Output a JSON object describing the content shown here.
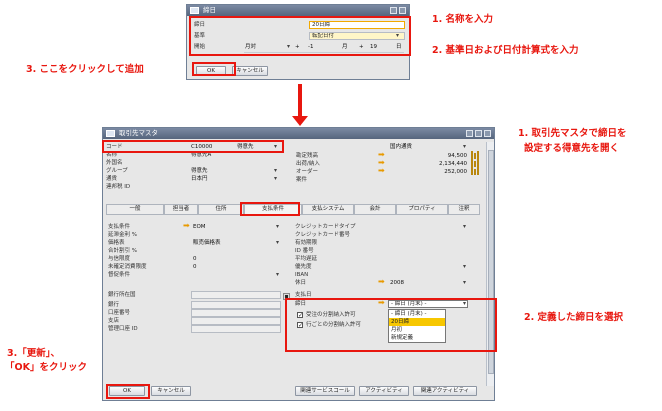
{
  "small_dialog": {
    "title": "締日",
    "fields": {
      "name_label": "締日",
      "name_value": "20日締",
      "base_label": "基準",
      "base_value": "転記日付",
      "start_label": "開始",
      "start_month": "月対",
      "plus1": "+",
      "day_offset": "-1",
      "month_unit": "月",
      "plus2": "+",
      "day_value": "19",
      "day_unit": "日"
    },
    "ok_label": "OK",
    "cancel_label": "キャンセル"
  },
  "main_window": {
    "title": "取引先マスタ",
    "header_left": [
      {
        "label": "コード",
        "value": "C10000"
      },
      {
        "label": "名称",
        "value": "得意先A"
      },
      {
        "label": "外国名",
        "value": ""
      },
      {
        "label": "グループ",
        "value": "得意先"
      },
      {
        "label": "通貨",
        "value": "日本円"
      },
      {
        "label": "連邦税 ID",
        "value": ""
      }
    ],
    "partner_type": "得意先",
    "currency_type": "国内通貨",
    "header_right": [
      {
        "label": "勘定残高",
        "value": "94,500"
      },
      {
        "label": "出荷/納入",
        "value": "2,134,440"
      },
      {
        "label": "オーダー",
        "value": "252,000"
      },
      {
        "label": "案件",
        "value": ""
      }
    ],
    "tabs": [
      "一般",
      "担当者",
      "住所",
      "支払条件",
      "支払システム",
      "会計",
      "プロパティ",
      "注釈"
    ],
    "pay_left": [
      {
        "label": "支払条件",
        "value": "EOM"
      },
      {
        "label": "延滞金利 %",
        "value": ""
      },
      {
        "label": "価格表",
        "value": "販売価格表"
      },
      {
        "label": "合計割引 %",
        "value": ""
      },
      {
        "label": "与信限度",
        "value": "0"
      },
      {
        "label": "未確定消費限度",
        "value": "0"
      },
      {
        "label": "督促条件",
        "value": ""
      }
    ],
    "pay_left2": [
      {
        "label": "銀行所在国",
        "value": ""
      },
      {
        "label": "銀行",
        "value": ""
      },
      {
        "label": "口座番号",
        "value": ""
      },
      {
        "label": "支店",
        "value": ""
      },
      {
        "label": "管理口座 ID",
        "value": ""
      }
    ],
    "pay_right": [
      {
        "label": "クレジットカードタイプ",
        "value": ""
      },
      {
        "label": "クレジットカード番号",
        "value": ""
      },
      {
        "label": "有効期限",
        "value": ""
      },
      {
        "label": "ID 番号",
        "value": ""
      },
      {
        "label": "平均遅延",
        "value": ""
      },
      {
        "label": "優先度",
        "value": ""
      },
      {
        "label": "IBAN",
        "value": ""
      },
      {
        "label": "休日",
        "value": "2008"
      },
      {
        "label": "支払日",
        "value": ""
      },
      {
        "label": "締日",
        "value": "- 締日 (月末) -"
      }
    ],
    "checks": [
      "受注の分割納入許可",
      "行ごとの分割納入許可"
    ],
    "dropdown_options": [
      "- 締日 (月末) -",
      "20日締",
      "月初",
      "新規定義"
    ],
    "dropdown_selected": 1,
    "ok_label": "OK",
    "cancel_label": "キャンセル",
    "bottom_buttons": [
      "関連サービスコール",
      "アクティビティ",
      "関連アクティビティ"
    ]
  },
  "callouts": {
    "c1": "1. 名称を入力",
    "c2": "2. 基準日および日付計算式を入力",
    "c3": "3. ここをクリックして追加",
    "r1_line1": "1. 取引先マスタで締日を",
    "r1_line2": "設定する得意先を開く",
    "r2": "2. 定義した締日を選択",
    "b3_line1": "3.「更新」、",
    "b3_line2": "「OK」をクリック"
  },
  "colors": {
    "accent": "#e8170f",
    "selection": "#f7c700",
    "title_bar": "#5f6e86"
  }
}
